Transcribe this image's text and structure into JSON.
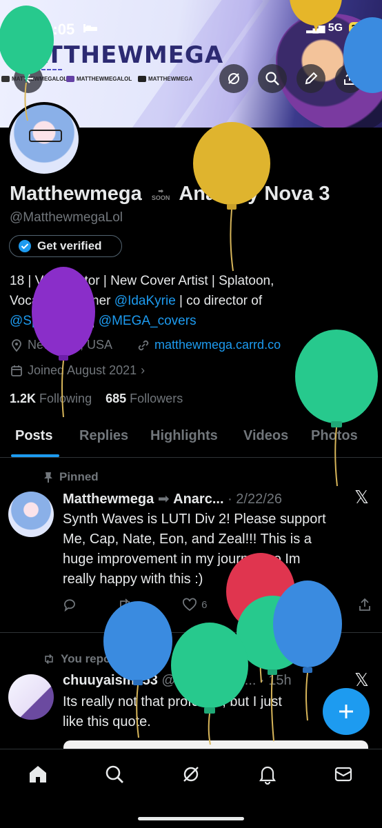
{
  "status_bar": {
    "time": "12:05",
    "network": "5G",
    "battery": "38"
  },
  "banner": {
    "title": "MATTHEWMEGA",
    "socials": [
      {
        "icon": "x-icon",
        "label": "MATTHEWMEGALOL"
      },
      {
        "icon": "twitch-icon",
        "label": "MATTHEWMEGALOL"
      },
      {
        "icon": "youtube-icon",
        "label": "MATTHEWMEGA"
      }
    ]
  },
  "profile": {
    "name_left": "Matthewmega",
    "soon_label": "SOON",
    "name_right": "Anarchy Nova 3",
    "handle": "@MatthewmegaLol",
    "verify_label": "Get verified",
    "bio": {
      "line1": "18 | Voice actor | New Cover Artist | Splatoon,",
      "line2_pre": "Vocaloid | banner ",
      "line2_link": "@IdaKyrie",
      "line2_post": " | co director of",
      "line3_link1": "@Splatfunkin",
      "line3_sep": " | ",
      "line3_link2": "@MEGA_covers"
    },
    "location": "New York, USA",
    "website": "matthewmega.carrd.co",
    "joined": "Joined August 2021",
    "following_count": "1.2K",
    "following_label": "Following",
    "followers_count": "685",
    "followers_label": "Followers"
  },
  "tabs": [
    "Posts",
    "Replies",
    "Highlights",
    "Videos",
    "Photos"
  ],
  "posts": [
    {
      "context": "Pinned",
      "author": "Matthewmega",
      "author_suffix": "Anarc...",
      "date": "· 2/22/26",
      "lines": [
        "Synth Waves is LUTI Div 2! Please support",
        "Me, Cap, Nate, Eon, and Zeal!!! This is a",
        "huge improvement in my journey so Im",
        "really happy with this :)"
      ],
      "reposts": "2",
      "likes": "6"
    },
    {
      "context": "You reposted",
      "author": "chuuyaism153",
      "handle": "@IsagiNation...",
      "date": "· 15h",
      "lines": [
        "Its really not that profound, but I just",
        "like this quote."
      ]
    }
  ],
  "fab_label": "+"
}
